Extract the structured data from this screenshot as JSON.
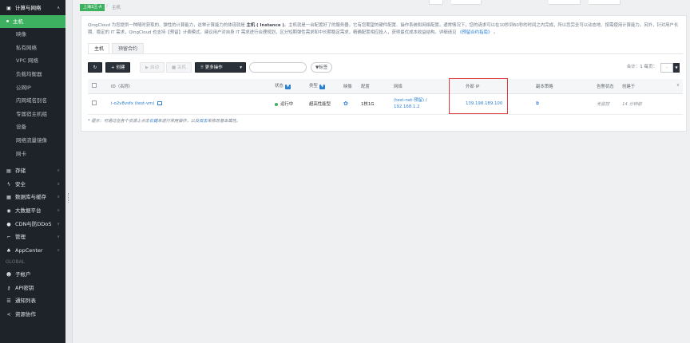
{
  "sidebar": {
    "top_section": {
      "label": "计算与网络",
      "icon": "compute-icon"
    },
    "compute_items": [
      {
        "label": "主机",
        "active": true
      },
      {
        "label": "映像"
      },
      {
        "label": "私有网络"
      },
      {
        "label": "VPC 网络"
      },
      {
        "label": "负载均衡器"
      },
      {
        "label": "公网IP"
      },
      {
        "label": "内网域名别名"
      },
      {
        "label": "专属宿主机组"
      },
      {
        "label": "设备"
      },
      {
        "label": "网络流量镜像"
      },
      {
        "label": "网卡"
      }
    ],
    "sections": [
      {
        "label": "存储",
        "icon": "storage-icon"
      },
      {
        "label": "安全",
        "icon": "security-icon"
      },
      {
        "label": "数据库与缓存",
        "icon": "database-icon"
      },
      {
        "label": "大数据平台",
        "icon": "bigdata-icon"
      },
      {
        "label": "CDN与防DDoS",
        "icon": "cdn-icon"
      },
      {
        "label": "管理",
        "icon": "management-icon"
      },
      {
        "label": "AppCenter",
        "icon": "appcenter-icon"
      }
    ],
    "global_label": "GLOBAL",
    "global_items": [
      {
        "label": "子帐户",
        "icon": "sub-account-icon"
      },
      {
        "label": "API密钥",
        "icon": "api-key-icon"
      },
      {
        "label": "通知列表",
        "icon": "notification-list-icon"
      },
      {
        "label": "资源协作",
        "icon": "resource-share-icon"
      }
    ]
  },
  "breadcrumb": {
    "zone": "上海1区-A",
    "current": "主机"
  },
  "description": {
    "part1": "QingCloud 为您提供一种随时获取的、弹性的计算能力，这种计算能力的体现就是 ",
    "bold": "主机 ( Instance )",
    "part2": "。主机就是一台配置好了的服务器，它有您期望的硬件配置、操作系统和网络配置。通常情况下，您的请求可以在10秒到60秒的时间之内完成，所以您完全可以动态地、按需使用计算能力。另外，针对用户长期、稳定的 IT 需求，QingCloud 也支持【预留】计费模式。建议用户对自身 IT 需求进行合理规划，区分短期弹性需求和中长期稳定需求，精确配置相应投入，获得最优成本收益结构。详细请见 ",
    "link": "《预留合约指南》",
    "part3": " 。"
  },
  "tabs": [
    {
      "label": "主机",
      "active": true
    },
    {
      "label": "预留合约"
    }
  ],
  "toolbar": {
    "refresh_icon": "refresh-icon",
    "create_label": "+ 创建",
    "start_label": "▶ 启动",
    "stop_label": "■ 关机",
    "more_label": "更多操作",
    "search_placeholder": "",
    "tag_label": "标签"
  },
  "pager": {
    "total_label": "合计：1 每页：",
    "page_size": "-"
  },
  "table": {
    "columns": [
      "ID（名称）",
      "状态",
      "类型",
      "映像",
      "配置",
      "网络",
      "外部 IP",
      "副本策略",
      "告警状态",
      "创建于"
    ],
    "rows": [
      {
        "id": "i-o2v8vsfx (test-vm)",
        "status": "运行中",
        "type": "超高性能型",
        "image_icon": "image-gear-icon",
        "config": "1核1G",
        "network_line1": "(test-net-预留) /",
        "network_line2": "192.168.1.2",
        "external_ip": "139.198.189.100",
        "replica_icon": "replica-policy-icon",
        "alarm": "无监控",
        "created": "14 分钟前"
      }
    ]
  },
  "tip": {
    "prefix": "* 提示：可通过在各个资源上点击",
    "link1": "右键",
    "middle": "来进行常用操作，以及",
    "link2": "双击",
    "suffix": "来修改基本属性。"
  },
  "colors": {
    "accent": "#3db15f",
    "sidebar_bg": "#1e2329",
    "link": "#2d7fd0",
    "highlight": "#e0393e"
  }
}
